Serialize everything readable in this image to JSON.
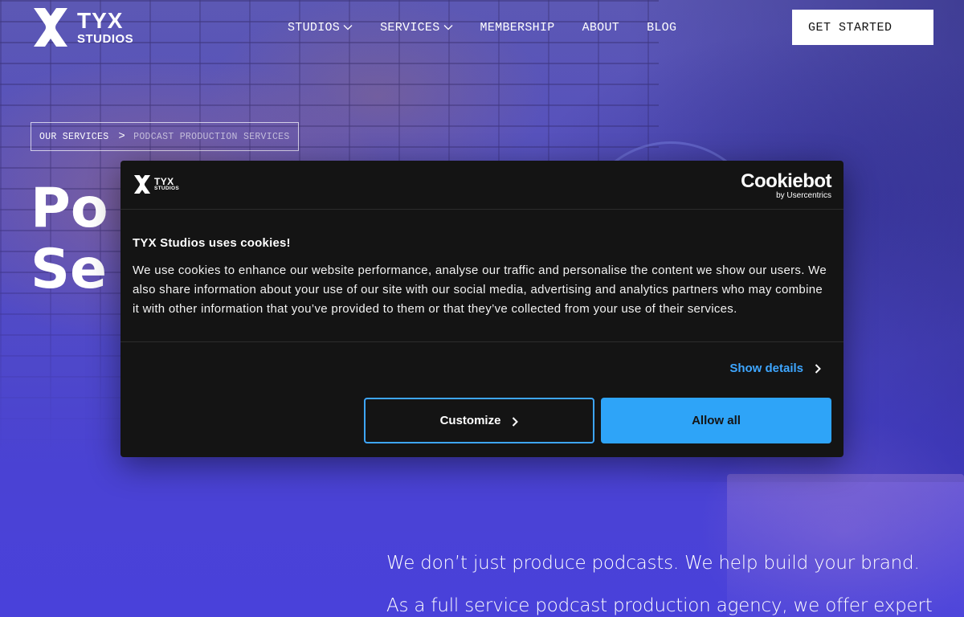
{
  "brand": {
    "logo_main": "TYX",
    "logo_sub": "STUDIOS"
  },
  "nav": {
    "items": [
      {
        "label": "STUDIOS",
        "has_dropdown": true
      },
      {
        "label": "SERVICES",
        "has_dropdown": true
      },
      {
        "label": "MEMBERSHIP",
        "has_dropdown": false
      },
      {
        "label": "ABOUT",
        "has_dropdown": false
      },
      {
        "label": "BLOG",
        "has_dropdown": false
      }
    ],
    "cta_label": "GET STARTED"
  },
  "breadcrumb": {
    "link": "OUR SERVICES",
    "separator": ">",
    "current": "PODCAST PRODUCTION SERVICES"
  },
  "hero": {
    "title_line1": "Po",
    "title_line2": "Se",
    "lead": "We don’t just produce podcasts. We help build your brand.",
    "body": "As a full service podcast production agency, we offer expert"
  },
  "cookie_dialog": {
    "logo_main": "TYX",
    "logo_sub": "STUDIOS",
    "provider_name": "Cookiebot",
    "provider_by": "by Usercentrics",
    "title": "TYX Studios uses cookies!",
    "text": "We use cookies to enhance our website performance, analyse our traffic and personalise the content we show our users. We also share information about your use of our site with our social media, advertising and analytics partners who may combine it with other information that you’ve provided to them or that they’ve collected from your use of their services.",
    "show_details_label": "Show details",
    "customize_label": "Customize",
    "allow_all_label": "Allow all"
  },
  "colors": {
    "accent_blue": "#2ea4f8",
    "link_blue": "#3ea6ff",
    "dialog_bg": "#141414",
    "hero_purple": "#4a45b8"
  },
  "icons": {
    "logo": "tyx-x-mark-icon",
    "dropdown": "chevron-down-icon",
    "details": "chevron-right-icon"
  }
}
